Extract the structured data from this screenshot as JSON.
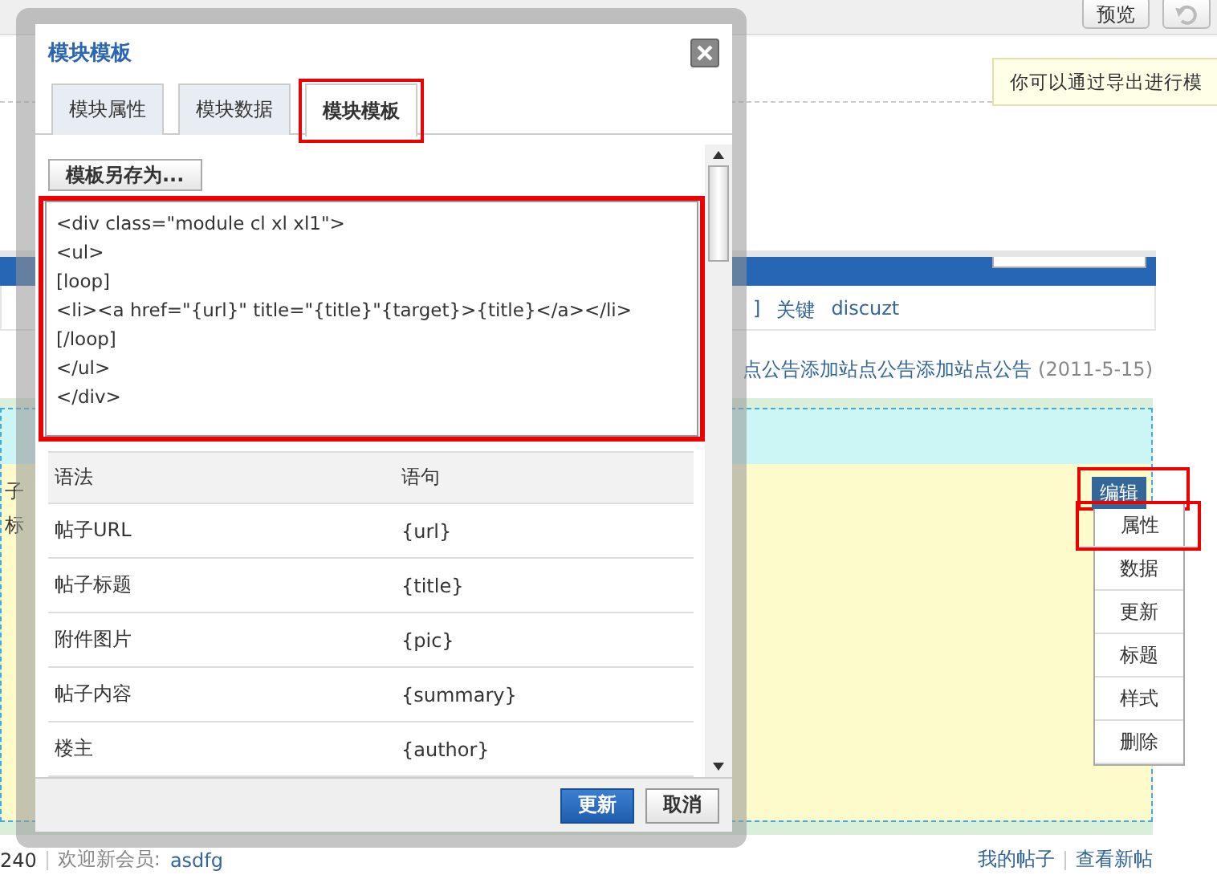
{
  "toolbar": {
    "preview_button": "预览"
  },
  "notice": "你可以通过导出进行模",
  "tag_bar": {
    "bracket": "]",
    "label": "关键",
    "tag": "discuzt"
  },
  "announcement": {
    "text": "点公告添加站点公告添加站点公告",
    "date": "(2011-5-15)"
  },
  "left_texts": [
    "子",
    "标"
  ],
  "block_menu": {
    "edit": {
      "label": "编辑",
      "highlighted": true
    },
    "items": [
      {
        "label": "属性",
        "highlighted": true
      },
      {
        "label": "数据",
        "highlighted": false
      },
      {
        "label": "更新",
        "highlighted": false
      },
      {
        "label": "标题",
        "highlighted": false
      },
      {
        "label": "样式",
        "highlighted": false
      },
      {
        "label": "删除",
        "highlighted": false
      }
    ]
  },
  "footer": {
    "count": "240",
    "welcome": "欢迎新会员:",
    "member": "asdfg",
    "links": [
      "我的帖子",
      "查看新帖"
    ]
  },
  "dialog": {
    "title": "模块模板",
    "tabs": [
      {
        "label": "模块属性",
        "selected": false,
        "highlighted": false
      },
      {
        "label": "模块数据",
        "selected": false,
        "highlighted": false
      },
      {
        "label": "模块模板",
        "selected": true,
        "highlighted": true
      }
    ],
    "save_as_button": "模板另存为...",
    "template_code": {
      "highlighted": true,
      "lines": [
        "<div class=\"module cl xl xl1\">",
        "<ul>",
        "[loop]",
        "<li><a href=\"{url}\" title=\"{title}\"{target}>{title}</a></li>",
        "[/loop]",
        "</ul>",
        "</div>"
      ]
    },
    "table": {
      "columns": [
        "语法",
        "语句"
      ],
      "rows": [
        [
          "帖子URL",
          "{url}"
        ],
        [
          "帖子标题",
          "{title}"
        ],
        [
          "附件图片",
          "{pic}"
        ],
        [
          "帖子内容",
          "{summary}"
        ],
        [
          "楼主",
          "{author}"
        ]
      ]
    },
    "buttons": [
      {
        "label": "更新",
        "kind": "primary"
      },
      {
        "label": "取消",
        "kind": "default"
      }
    ]
  }
}
